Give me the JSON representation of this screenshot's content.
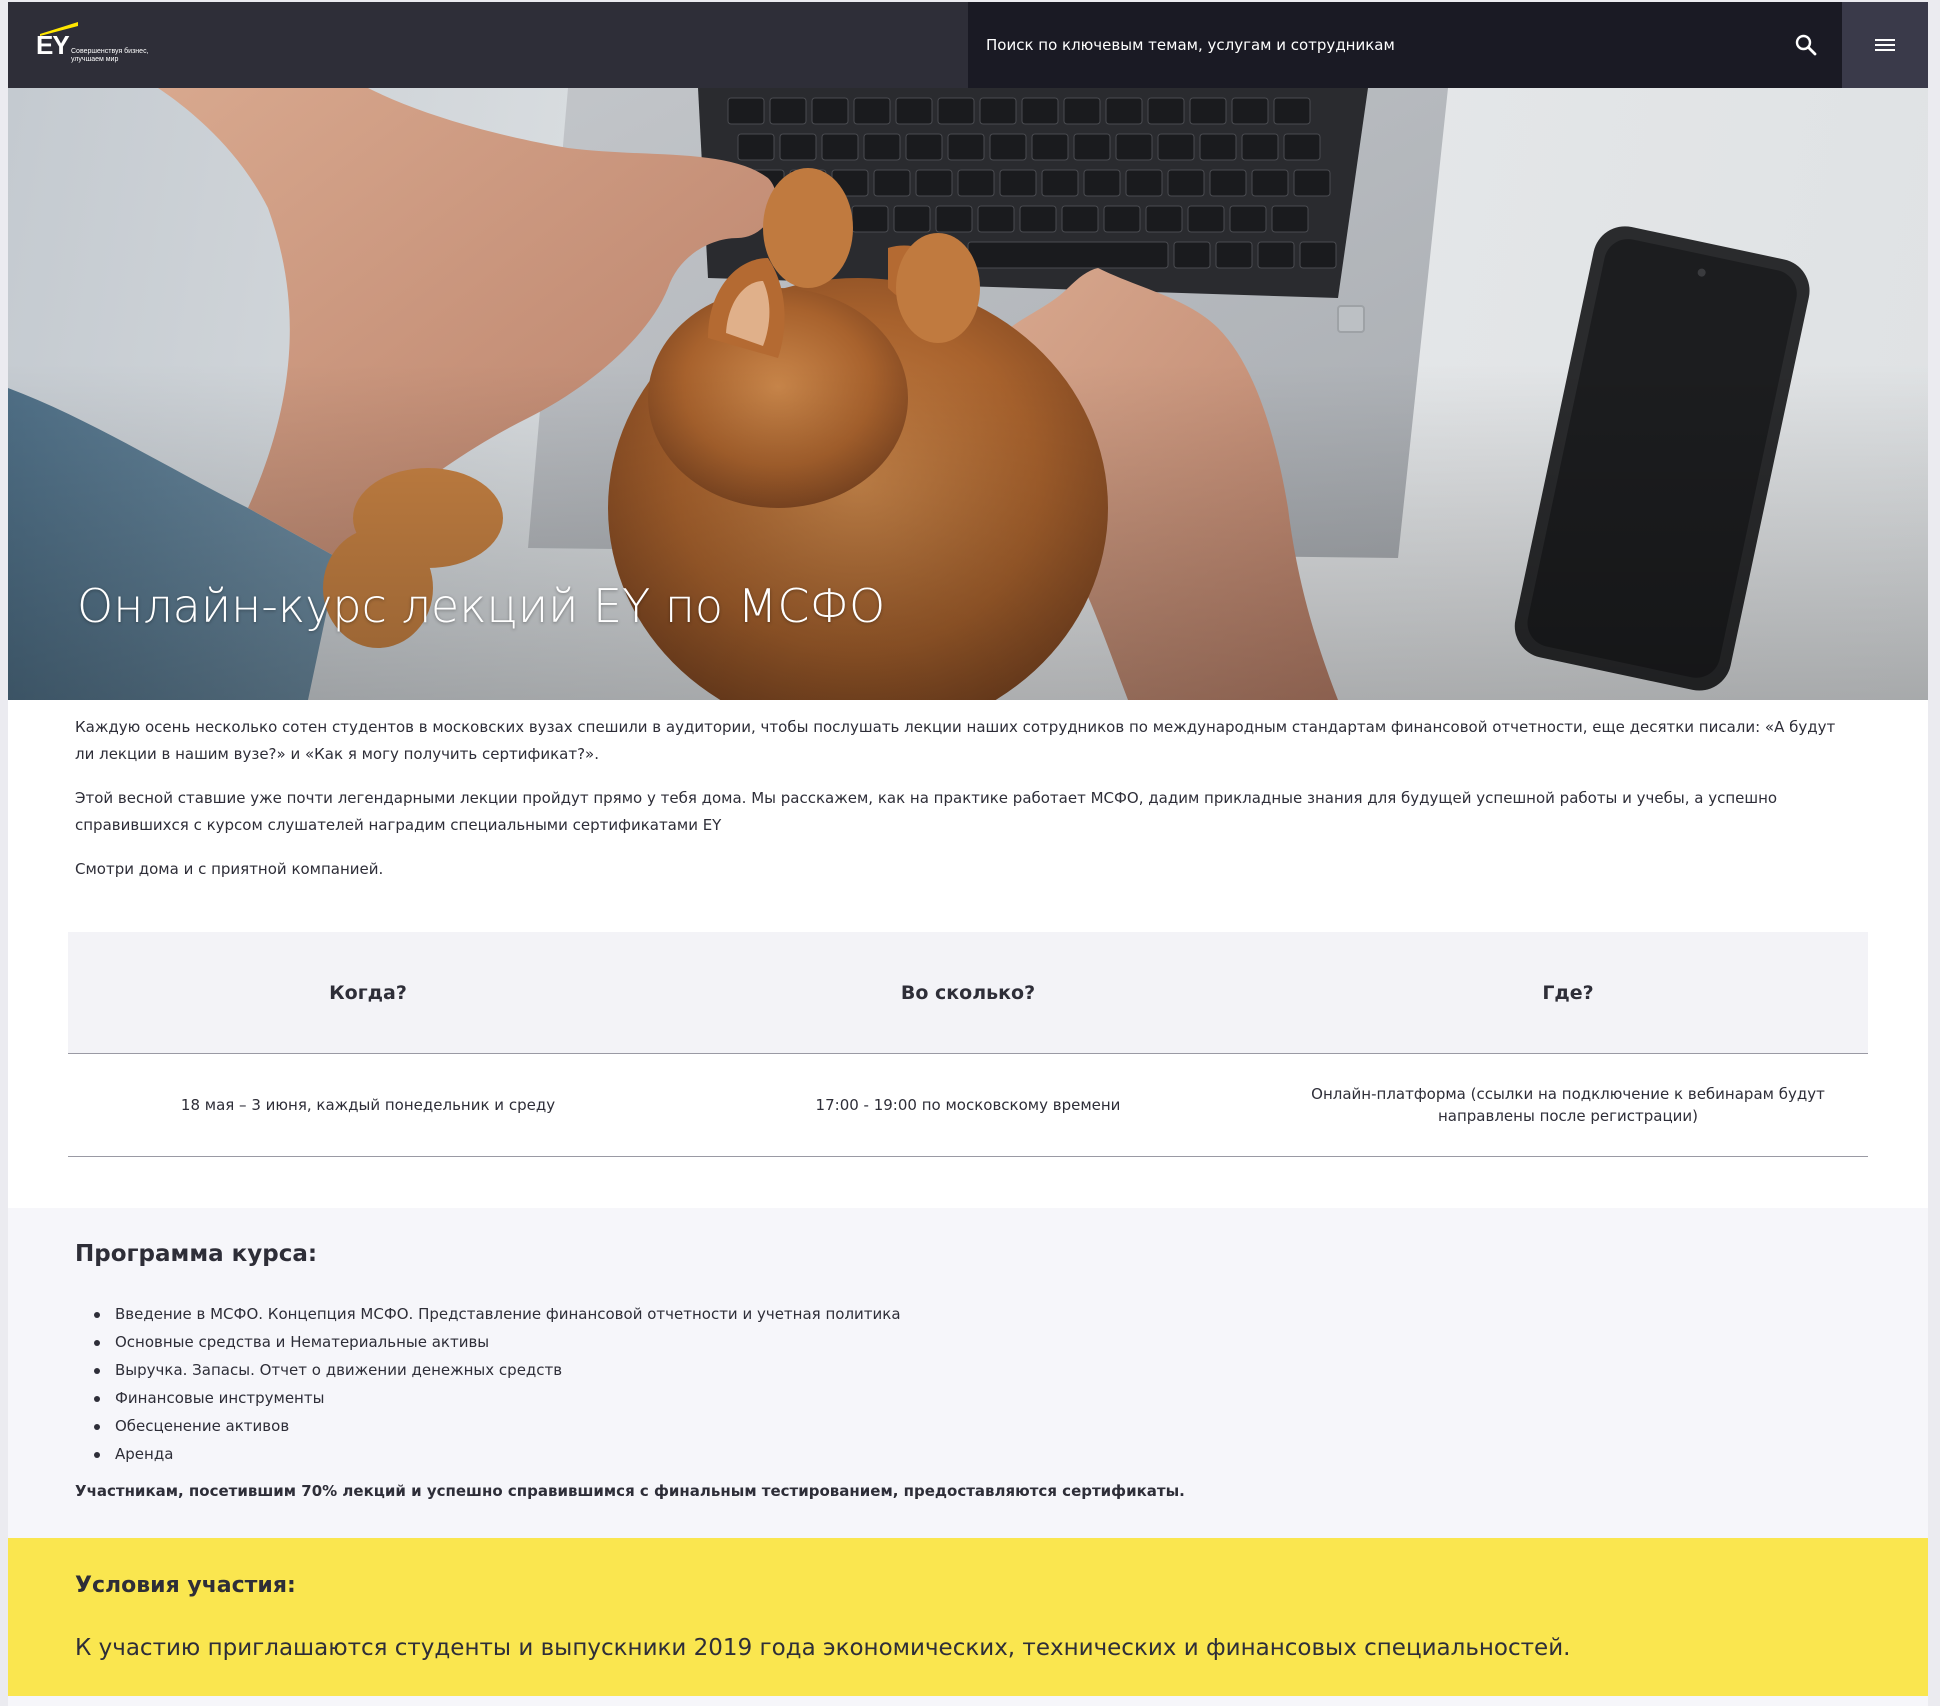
{
  "header": {
    "logo_text": "EY",
    "logo_tagline": "Совершенствуя бизнес, улучшаем мир",
    "search_placeholder": "Поиск по ключевым темам, услугам и сотрудникам",
    "search_icon": "search-icon",
    "menu_icon": "hamburger-menu-icon"
  },
  "hero": {
    "title": "Онлайн-курс лекций EY по МСФО"
  },
  "intro": {
    "paragraphs": [
      "Каждую осень несколько сотен студентов в московских вузах спешили в аудитории, чтобы послушать лекции наших сотрудников по международным стандартам финансовой отчетности, еще десятки писали: «А будут ли лекции в нашим вузе?» и «Как я могу получить сертификат?».",
      "Этой весной ставшие уже почти легендарными лекции пройдут прямо у тебя дома. Мы расскажем, как на практике работает МСФО, дадим прикладные знания для будущей успешной работы и учебы, а успешно справившихся с курсом слушателей наградим специальными сертификатами EY",
      "Смотри дома и с приятной компанией."
    ]
  },
  "info_table": {
    "headers": [
      "Когда?",
      "Во сколько?",
      "Где?"
    ],
    "values": [
      "18 мая – 3 июня, каждый понедельник и среду",
      "17:00 - 19:00 по московскому времени",
      "Онлайн-платформа (ссылки на подключение к вебинарам будут направлены после регистрации)"
    ]
  },
  "program": {
    "title": "Программа курса:",
    "items": [
      "Введение в МСФО. Концепция МСФО. Представление финансовой отчетности и учетная политика",
      "Основные средства и Нематериальные активы",
      "Выручка. Запасы. Отчет о движении денежных средств",
      "Финансовые инструменты",
      "Обесценение активов",
      "Аренда"
    ],
    "note": "Участникам, посетившим 70% лекций и успешно справившимся с финальным тестированием, предоставляются сертификаты."
  },
  "conditions": {
    "title": "Условия участия",
    "title_suffix": ":",
    "text": "К участию приглашаются студенты и выпускники 2019 года экономических, технических и финансовых специальностей."
  },
  "colors": {
    "header_bg": "#2e2e38",
    "search_bg": "#1a1a24",
    "brand_yellow": "#ffe600",
    "conditions_bg": "#fae64f",
    "text_dark": "#2e2e38",
    "page_bg": "#f6f6fa"
  }
}
